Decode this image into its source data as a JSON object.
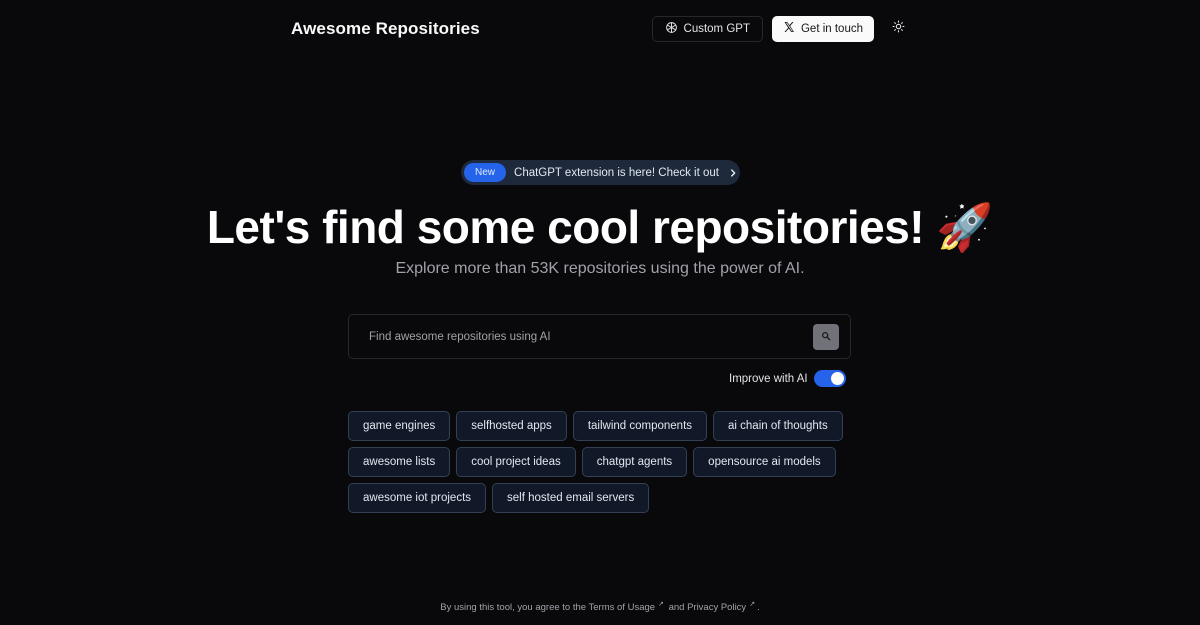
{
  "header": {
    "brand": "Awesome Repositories",
    "custom_gpt_label": "Custom GPT",
    "get_in_touch_label": "Get in touch",
    "icons": {
      "custom_gpt": "openai-icon",
      "get_in_touch": "x-logo-icon",
      "theme": "sun-icon"
    }
  },
  "announcement": {
    "badge": "New",
    "message": "ChatGPT extension is here! Check it out",
    "icon": "chevron-right-icon"
  },
  "hero": {
    "title": "Let's find some cool repositories! 🚀",
    "subtitle": "Explore more than 53K repositories using the power of AI."
  },
  "search": {
    "placeholder": "Find awesome repositories using AI",
    "value": "",
    "button_icon": "search-icon"
  },
  "improve_with_ai": {
    "label": "Improve with AI",
    "enabled": true
  },
  "suggestions": [
    "game engines",
    "selfhosted apps",
    "tailwind components",
    "ai chain of thoughts",
    "awesome lists",
    "cool project ideas",
    "chatgpt agents",
    "opensource ai models",
    "awesome iot projects",
    "self hosted email servers"
  ],
  "footer": {
    "prefix": "By using this tool, you agree to the",
    "terms_label": "Terms of Usage",
    "and": "and",
    "privacy_label": "Privacy Policy",
    "suffix": ".",
    "ext_icon": "↗"
  },
  "colors": {
    "background": "#09090b",
    "accent": "#2563eb",
    "chip_bg": "#111827",
    "chip_border": "#334155"
  }
}
